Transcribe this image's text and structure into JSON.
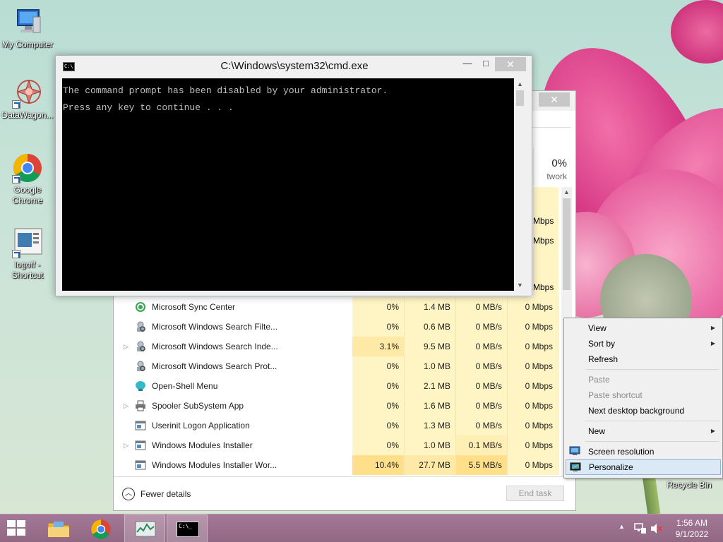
{
  "desktop": {
    "icons": [
      {
        "label": "My Computer"
      },
      {
        "label": "DataWagon..."
      },
      {
        "label": "Google\nChrome"
      },
      {
        "label": "logoff -\nShortcut"
      }
    ],
    "recycle_bin": "Recycle Bin"
  },
  "cmd": {
    "title": "C:\\Windows\\system32\\cmd.exe",
    "icon_text": "C:\\",
    "minimize": "—",
    "maximize": "□",
    "close": "✕",
    "lines": [
      "The command prompt has been disabled by your administrator.",
      "Press any key to continue . . ."
    ]
  },
  "taskmgr": {
    "close": "✕",
    "header": {
      "network_pct": "0%",
      "network_label": "twork"
    },
    "partial_net": [
      "Mbps",
      "Mbps",
      "Mbps"
    ],
    "rows": [
      {
        "name": "Microsoft Sync Center",
        "cpu": "0%",
        "mem": "1.4 MB",
        "disk": "0 MB/s",
        "net": "0 Mbps",
        "expand": ""
      },
      {
        "name": "Microsoft Windows Search Filte...",
        "cpu": "0%",
        "mem": "0.6 MB",
        "disk": "0 MB/s",
        "net": "0 Mbps",
        "expand": ""
      },
      {
        "name": "Microsoft Windows Search Inde...",
        "cpu": "3.1%",
        "mem": "9.5 MB",
        "disk": "0 MB/s",
        "net": "0 Mbps",
        "expand": "▷"
      },
      {
        "name": "Microsoft Windows Search Prot...",
        "cpu": "0%",
        "mem": "1.0 MB",
        "disk": "0 MB/s",
        "net": "0 Mbps",
        "expand": ""
      },
      {
        "name": "Open-Shell Menu",
        "cpu": "0%",
        "mem": "2.1 MB",
        "disk": "0 MB/s",
        "net": "0 Mbps",
        "expand": ""
      },
      {
        "name": "Spooler SubSystem App",
        "cpu": "0%",
        "mem": "1.6 MB",
        "disk": "0 MB/s",
        "net": "0 Mbps",
        "expand": "▷"
      },
      {
        "name": "Userinit Logon Application",
        "cpu": "0%",
        "mem": "1.3 MB",
        "disk": "0 MB/s",
        "net": "0 Mbps",
        "expand": ""
      },
      {
        "name": "Windows Modules Installer",
        "cpu": "0%",
        "mem": "1.0 MB",
        "disk": "0.1 MB/s",
        "net": "0 Mbps",
        "expand": "▷"
      },
      {
        "name": "Windows Modules Installer Wor...",
        "cpu": "10.4%",
        "mem": "27.7 MB",
        "disk": "5.5 MB/s",
        "net": "0 Mbps",
        "expand": ""
      }
    ],
    "fewer_details": "Fewer details",
    "end_task": "End task"
  },
  "context_menu": {
    "view": "View",
    "sort_by": "Sort by",
    "refresh": "Refresh",
    "paste": "Paste",
    "paste_shortcut": "Paste shortcut",
    "next_bg": "Next desktop background",
    "new": "New",
    "screen_res": "Screen resolution",
    "personalize": "Personalize"
  },
  "taskbar": {
    "time": "1:56 AM",
    "date": "9/1/2022",
    "cmd_icon_text": "C:\\_"
  },
  "colors": {
    "taskbar": "#9a6e8c",
    "console_bg": "#000000",
    "console_fg": "#c0c0c0",
    "cpu_highlight": "#fff4c4"
  }
}
